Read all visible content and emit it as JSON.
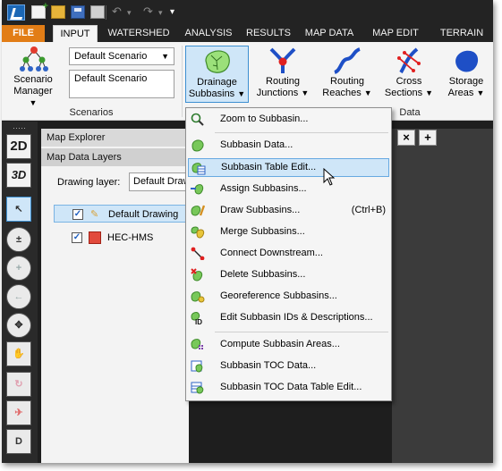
{
  "quick_access": {
    "icons": [
      "new-project-icon",
      "open-icon",
      "save-icon",
      "email-icon",
      "undo-icon",
      "redo-icon"
    ]
  },
  "tabs": [
    "FILE",
    "INPUT",
    "WATERSHED",
    "ANALYSIS",
    "RESULTS",
    "MAP DATA",
    "MAP EDIT",
    "TERRAIN"
  ],
  "active_tab": "INPUT",
  "ribbon": {
    "scenario_manager": {
      "line1": "Scenario",
      "line2": "Manager"
    },
    "scenario_combo": "Default Scenario",
    "scenario_text": "Default Scenario",
    "scenarios_group_label": "Scenarios",
    "data_group_label": "Data",
    "buttons": [
      {
        "line1": "Drainage",
        "line2": "Subbasins"
      },
      {
        "line1": "Routing",
        "line2": "Junctions"
      },
      {
        "line1": "Routing",
        "line2": "Reaches"
      },
      {
        "line1": "Cross",
        "line2": "Sections"
      },
      {
        "line1": "Storage",
        "line2": "Areas"
      }
    ]
  },
  "left_tools": [
    "2D",
    "3D"
  ],
  "map_explorer": {
    "title": "Map Explorer",
    "layers_title": "Map Data Layers",
    "drawing_layer_label": "Drawing layer:",
    "drawing_layer_value": "Default Drawi",
    "layers": [
      "Default Drawing",
      "HEC-HMS"
    ]
  },
  "doc_tabs": {
    "close": "×",
    "add": "+"
  },
  "menu": {
    "items": [
      {
        "label": "Zoom to Subbasin...",
        "shortcut": ""
      },
      {
        "label": "Subbasin Data...",
        "shortcut": ""
      },
      {
        "label": "Subbasin Table Edit...",
        "shortcut": ""
      },
      {
        "label": "Assign Subbasins...",
        "shortcut": ""
      },
      {
        "label": "Draw Subbasins...",
        "shortcut": "(Ctrl+B)"
      },
      {
        "label": "Merge Subbasins...",
        "shortcut": ""
      },
      {
        "label": "Connect Downstream...",
        "shortcut": ""
      },
      {
        "label": "Delete Subbasins...",
        "shortcut": ""
      },
      {
        "label": "Georeference Subbasins...",
        "shortcut": ""
      },
      {
        "label": "Edit Subbasin IDs & Descriptions...",
        "shortcut": ""
      },
      {
        "label": "Compute Subbasin Areas...",
        "shortcut": ""
      },
      {
        "label": "Subbasin TOC Data...",
        "shortcut": ""
      },
      {
        "label": "Subbasin TOC Data Table Edit...",
        "shortcut": ""
      }
    ],
    "highlighted_index": 2
  },
  "colors": {
    "file_tab": "#e27d16",
    "highlight": "#cfe6f8",
    "highlight_border": "#67a9e1",
    "title_bar": "#232323"
  }
}
